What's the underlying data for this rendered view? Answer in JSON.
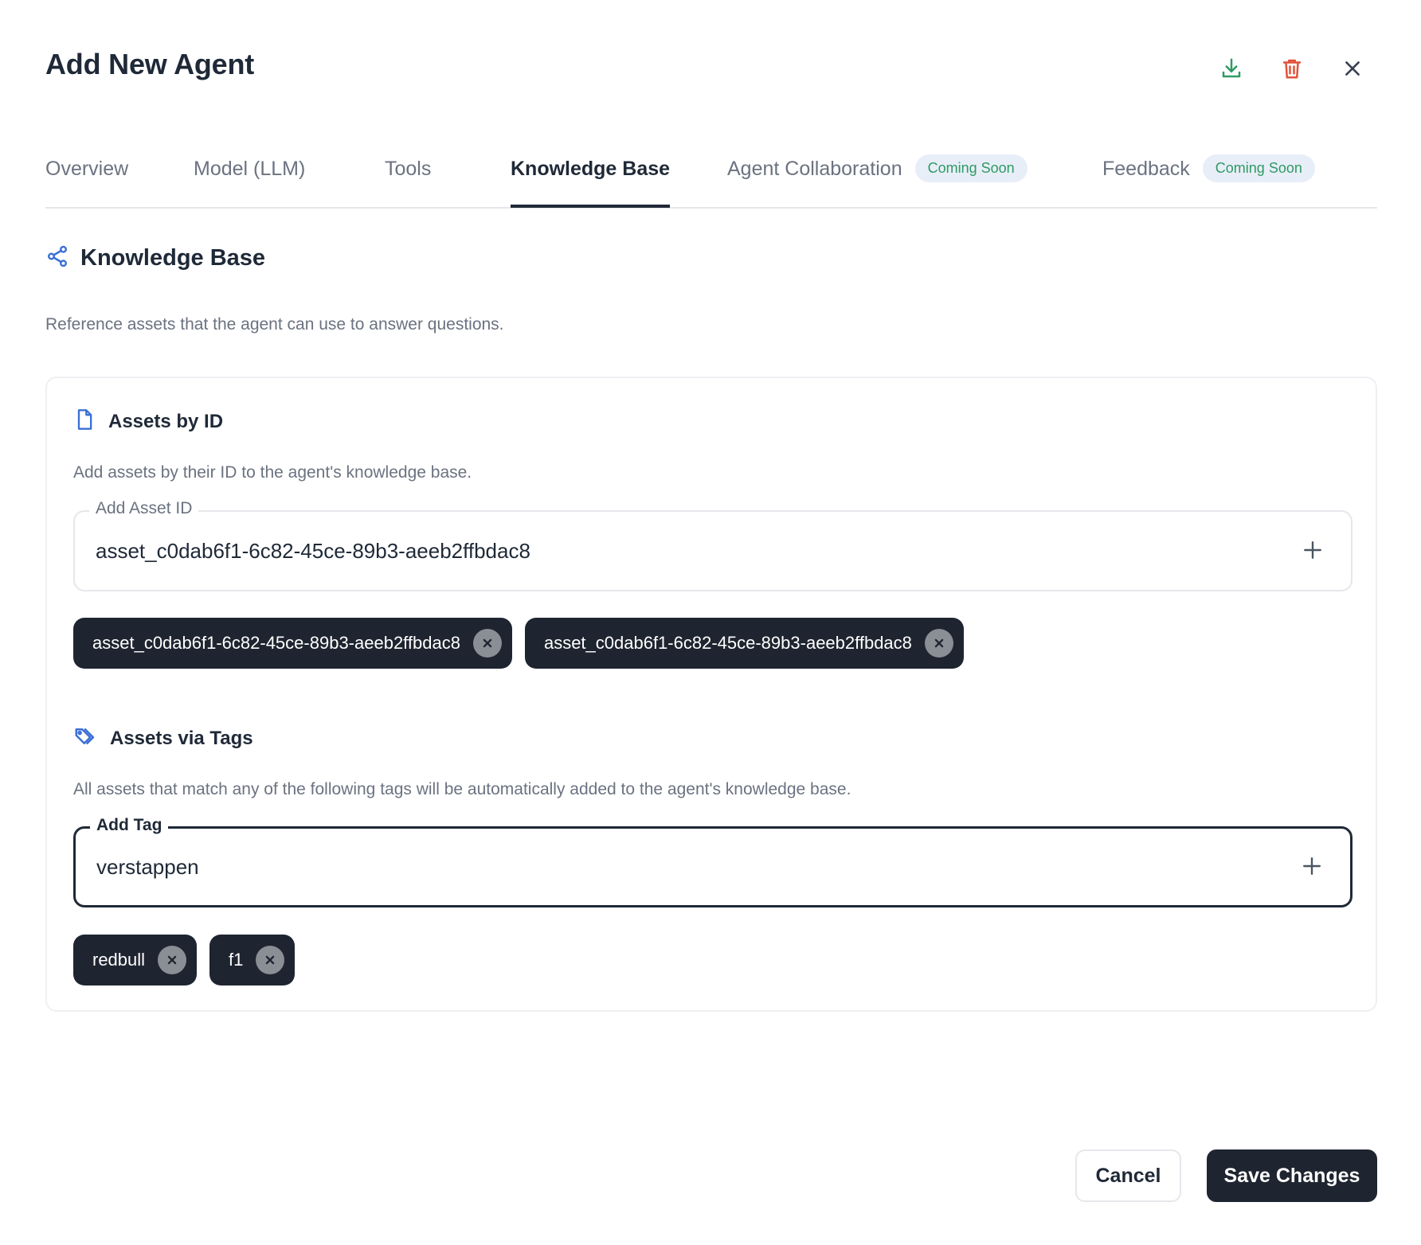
{
  "dialog": {
    "title": "Add New Agent"
  },
  "header_icons": [
    "download-icon",
    "trash-icon",
    "close-icon"
  ],
  "colors": {
    "download_icon": "#2f9a62",
    "delete_icon": "#e0533a",
    "accent_blue": "#3b6fd6",
    "dark": "#1f2530",
    "badge_bg": "#e8eef8",
    "badge_text": "#2f9a62"
  },
  "tabs": [
    {
      "label": "Overview",
      "active": false
    },
    {
      "label": "Model (LLM)",
      "active": false
    },
    {
      "label": "Tools",
      "active": false
    },
    {
      "label": "Knowledge Base",
      "active": true
    },
    {
      "label": "Agent Collaboration",
      "badge": "Coming Soon",
      "active": false
    },
    {
      "label": "Feedback",
      "badge": "Coming Soon",
      "active": false
    }
  ],
  "knowledge_base": {
    "title": "Knowledge Base",
    "description": "Reference assets that the agent can use to answer questions.",
    "assets_by_id": {
      "title": "Assets by ID",
      "description": "Add assets by their ID to the agent's knowledge base.",
      "field_label": "Add Asset ID",
      "field_value": "asset_c0dab6f1-6c82-45ce-89b3-aeeb2ffbdac8",
      "chips": [
        "asset_c0dab6f1-6c82-45ce-89b3-aeeb2ffbdac8",
        "asset_c0dab6f1-6c82-45ce-89b3-aeeb2ffbdac8"
      ]
    },
    "assets_via_tags": {
      "title": "Assets via Tags",
      "description": "All assets that match any of the following tags will be automatically added to the agent's knowledge base.",
      "field_label": "Add Tag",
      "field_value": "verstappen",
      "chips": [
        "redbull",
        "f1"
      ]
    }
  },
  "footer": {
    "cancel_label": "Cancel",
    "save_label": "Save Changes"
  }
}
